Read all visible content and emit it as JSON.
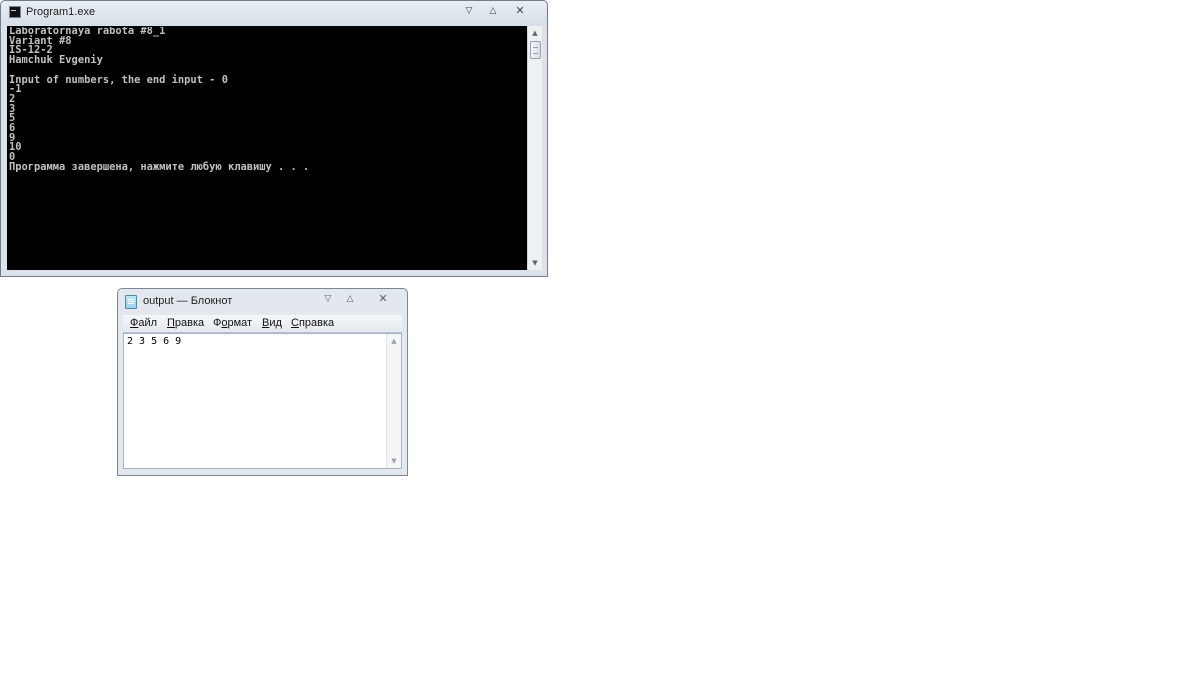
{
  "console": {
    "title": "Program1.exe",
    "lines": [
      "Laboratornaya rabota #8_1",
      "Variant #8",
      "IS-12-2",
      "Hamchuk Evgeniy",
      "",
      "Input of numbers, the end input - 0",
      "-1",
      "2",
      "3",
      "5",
      "6",
      "9",
      "10",
      "0",
      "Программа завершена, нажмите любую клавишу . . ."
    ],
    "text_color": "#c0c0c0",
    "background": "#000000"
  },
  "notepad": {
    "title": "output — Блокнот",
    "menu": [
      {
        "underline": "Ф",
        "rest": "айл"
      },
      {
        "underline": "П",
        "rest": "равка"
      },
      {
        "underline": "",
        "pre": "Ф",
        "underline2": "о",
        "rest": "рмат"
      },
      {
        "underline": "В",
        "rest": "ид"
      },
      {
        "underline": "С",
        "rest": "правка"
      }
    ],
    "content": "2 3 5 6 9"
  },
  "icons": {
    "minimize": "▽",
    "maximize": "△",
    "close": "✕",
    "scroll_up": "▲",
    "scroll_down": "▼"
  }
}
